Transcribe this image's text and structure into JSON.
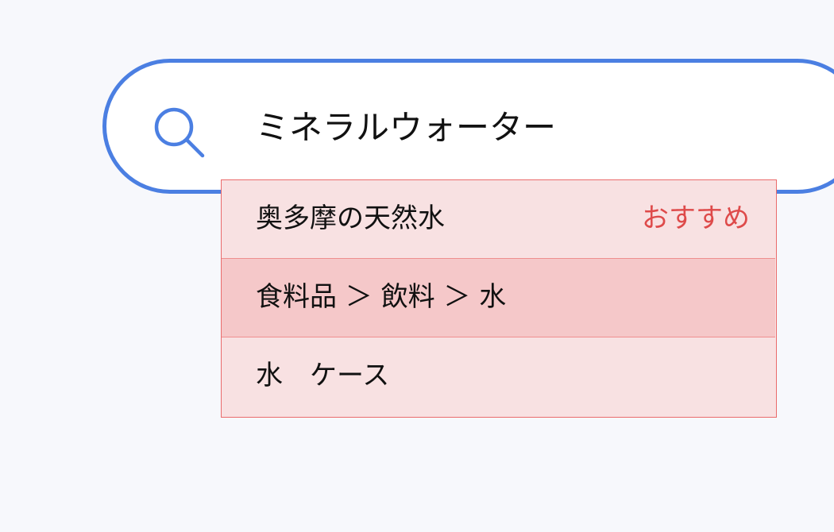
{
  "search": {
    "query": "ミネラルウォーター",
    "icon": "search-icon"
  },
  "suggestions": [
    {
      "label": "奥多摩の天然水",
      "badge": "おすすめ"
    },
    {
      "label": "食料品 ＞ 飲料 ＞ 水"
    },
    {
      "label": "水　ケース"
    }
  ],
  "colors": {
    "accent": "#4b7fe2",
    "dropdown_bg": "#f8e1e2",
    "highlight_bg": "#f5c8c9",
    "border": "#ea6b6b",
    "badge": "#de4a4a"
  }
}
